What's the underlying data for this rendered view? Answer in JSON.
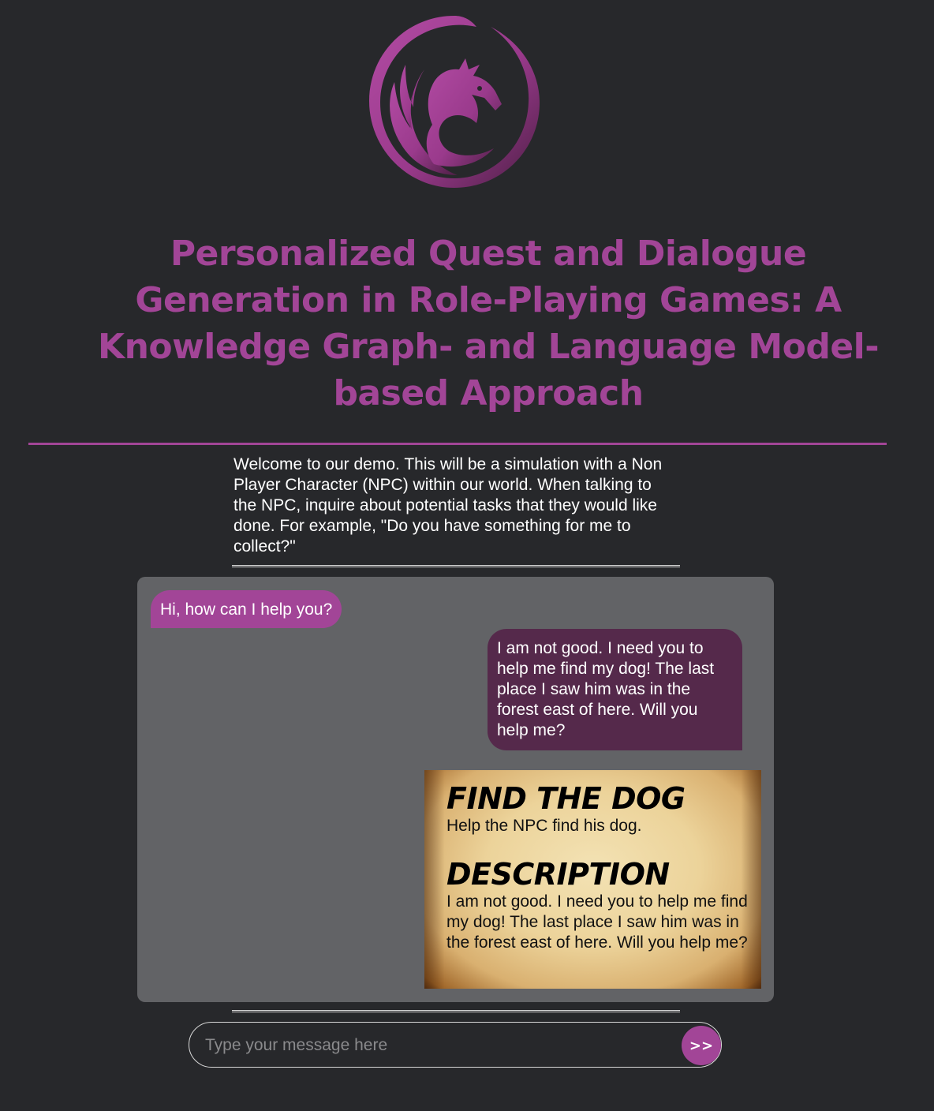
{
  "header": {
    "logo": "dragon-logo",
    "title": "Personalized Quest and Dialogue Generation in Role-Playing Games: A Knowledge Graph- and Language Model-based Approach"
  },
  "intro": {
    "text": "Welcome to our demo. This will be a simulation with a Non Player Character (NPC) within our world. When talking to the NPC, inquire about potential tasks that they would like done. For example, \"Do you have something for me to collect?\""
  },
  "chat": {
    "messages": [
      {
        "role": "npc",
        "text": "Hi, how can I help you?"
      },
      {
        "role": "user",
        "text": "I am not good. I need you to help me find my dog! The last place I saw him was in the forest east of here. Will you help me?"
      }
    ],
    "quest": {
      "title": "FIND THE DOG",
      "summary": "Help the NPC find his dog.",
      "description_heading": "DESCRIPTION",
      "description": "I am not good. I need you to help me find my dog! The last place I saw him was in the forest east of here. Will you help me?"
    }
  },
  "composer": {
    "placeholder": "Type your message here",
    "send_label": ">>"
  },
  "colors": {
    "accent": "#a24597",
    "background": "#27282b",
    "panel": "#626366",
    "user_bubble": "#55294b"
  }
}
